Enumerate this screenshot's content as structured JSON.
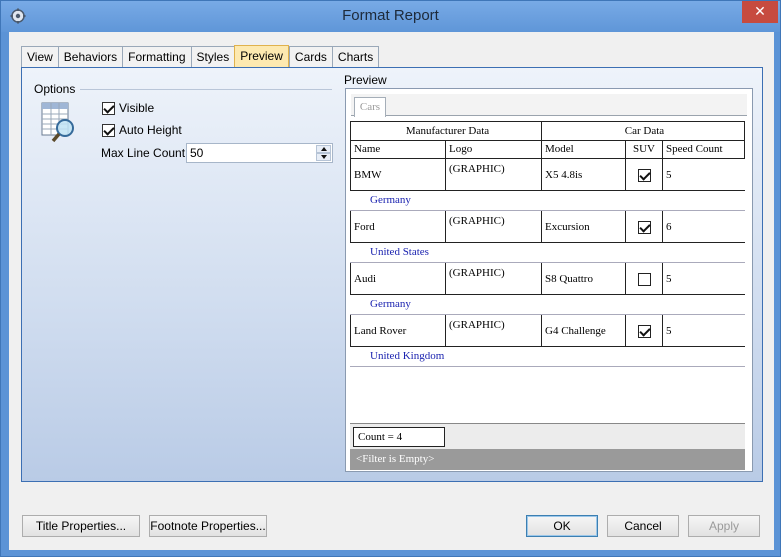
{
  "window": {
    "title": "Format Report",
    "close_glyph": "✕"
  },
  "tabs": [
    "View",
    "Behaviors",
    "Formatting",
    "Styles",
    "Preview",
    "Cards",
    "Charts"
  ],
  "active_tab": "Preview",
  "options": {
    "label": "Options",
    "visible": {
      "label": "Visible",
      "checked": true
    },
    "auto_height": {
      "label": "Auto Height",
      "checked": true
    },
    "max_line_count": {
      "label": "Max Line Count:",
      "value": "50"
    }
  },
  "preview": {
    "label": "Preview",
    "tab": "Cars",
    "group_headers": [
      "Manufacturer Data",
      "Car Data"
    ],
    "columns": [
      "Name",
      "Logo",
      "Model",
      "SUV",
      "Speed Count"
    ],
    "rows": [
      {
        "name": "BMW",
        "logo": "(GRAPHIC)",
        "model": "X5 4.8is",
        "suv": true,
        "speed": "5",
        "country": "Germany"
      },
      {
        "name": "Ford",
        "logo": "(GRAPHIC)",
        "model": "Excursion",
        "suv": true,
        "speed": "6",
        "country": "United States"
      },
      {
        "name": "Audi",
        "logo": "(GRAPHIC)",
        "model": "S8 Quattro",
        "suv": false,
        "speed": "5",
        "country": "Germany"
      },
      {
        "name": "Land Rover",
        "logo": "(GRAPHIC)",
        "model": "G4 Challenge",
        "suv": true,
        "speed": "5",
        "country": "United Kingdom"
      }
    ],
    "count": "Count = 4",
    "filter": "<Filter is Empty>"
  },
  "buttons": {
    "title_properties": "Title Properties...",
    "footnote_properties": "Footnote Properties...",
    "ok": "OK",
    "cancel": "Cancel",
    "apply": "Apply"
  },
  "icons": {
    "title": "gear-icon",
    "options": "table-search-icon"
  },
  "colors": {
    "accent": "#3c6fb3",
    "active_tab": "#fde9b0",
    "country_text": "#1b23b0"
  }
}
